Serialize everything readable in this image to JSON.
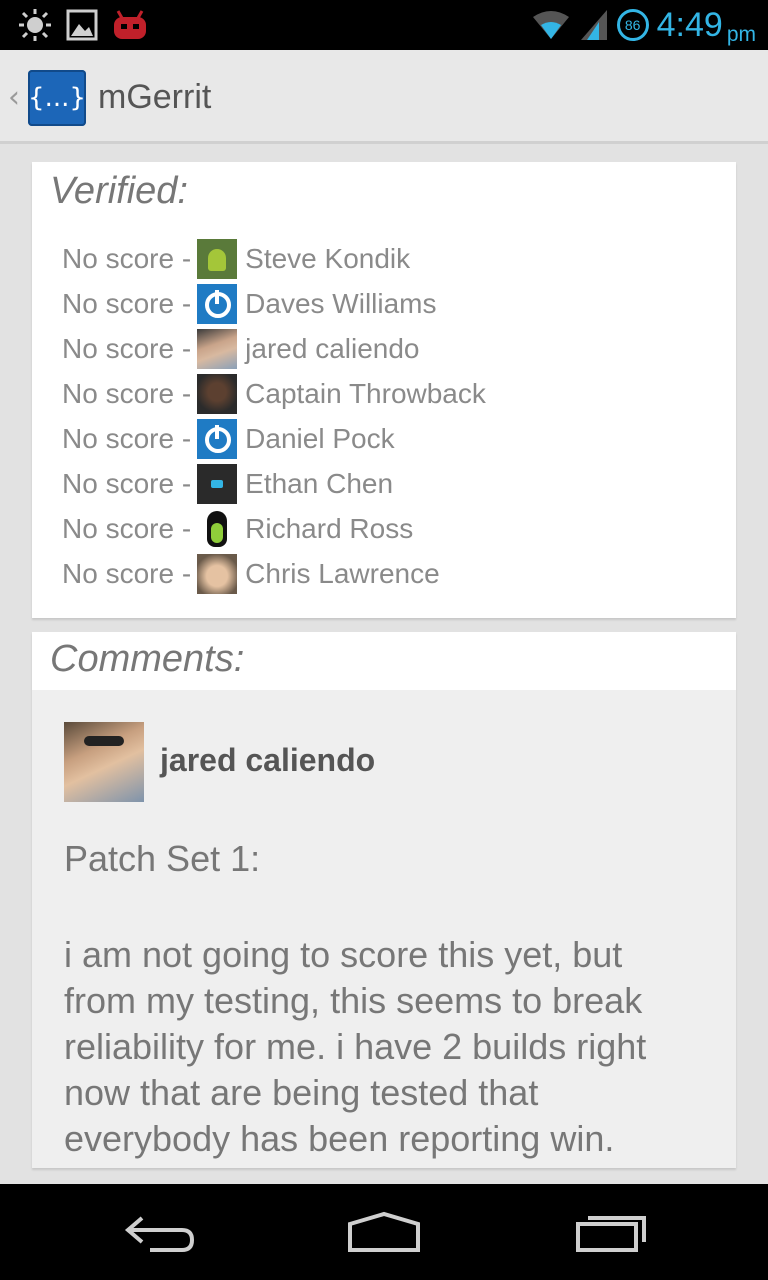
{
  "status_bar": {
    "time": "4:49",
    "ampm": "pm",
    "battery": "86",
    "icons": [
      "brightness-icon",
      "picture-icon",
      "cyanogenmod-icon",
      "wifi-icon",
      "signal-icon",
      "battery-icon"
    ]
  },
  "action_bar": {
    "app_icon_text": "{...}",
    "title": "mGerrit"
  },
  "verified": {
    "header": "Verified:",
    "reviews": [
      {
        "score": "No score -",
        "name": "Steve Kondik",
        "avatar": "android-avatar"
      },
      {
        "score": "No score -",
        "name": "Daves Williams",
        "avatar": "power-avatar"
      },
      {
        "score": "No score -",
        "name": "jared caliendo",
        "avatar": "photo-avatar"
      },
      {
        "score": "No score -",
        "name": "Captain Throwback",
        "avatar": "photo-avatar"
      },
      {
        "score": "No score -",
        "name": "Daniel Pock",
        "avatar": "power-avatar"
      },
      {
        "score": "No score -",
        "name": "Ethan Chen",
        "avatar": "htc-avatar"
      },
      {
        "score": "No score -",
        "name": "Richard Ross",
        "avatar": "tux-avatar"
      },
      {
        "score": "No score -",
        "name": "Chris Lawrence",
        "avatar": "photo-avatar"
      }
    ]
  },
  "comments": {
    "header": "Comments:",
    "items": [
      {
        "author": "jared caliendo",
        "patch_set": "Patch Set 1:",
        "body": "i am not going to score this yet, but from my testing, this seems to break reliability for me. i have 2 builds right now that are being tested that everybody has been reporting win."
      }
    ]
  },
  "nav_bar": {
    "buttons": [
      "back",
      "home",
      "recent-apps"
    ]
  },
  "colors": {
    "accent": "#33b5e5",
    "app_icon": "#1c66b8",
    "text_muted": "#8a8a8a",
    "background": "#e2e2e2"
  }
}
